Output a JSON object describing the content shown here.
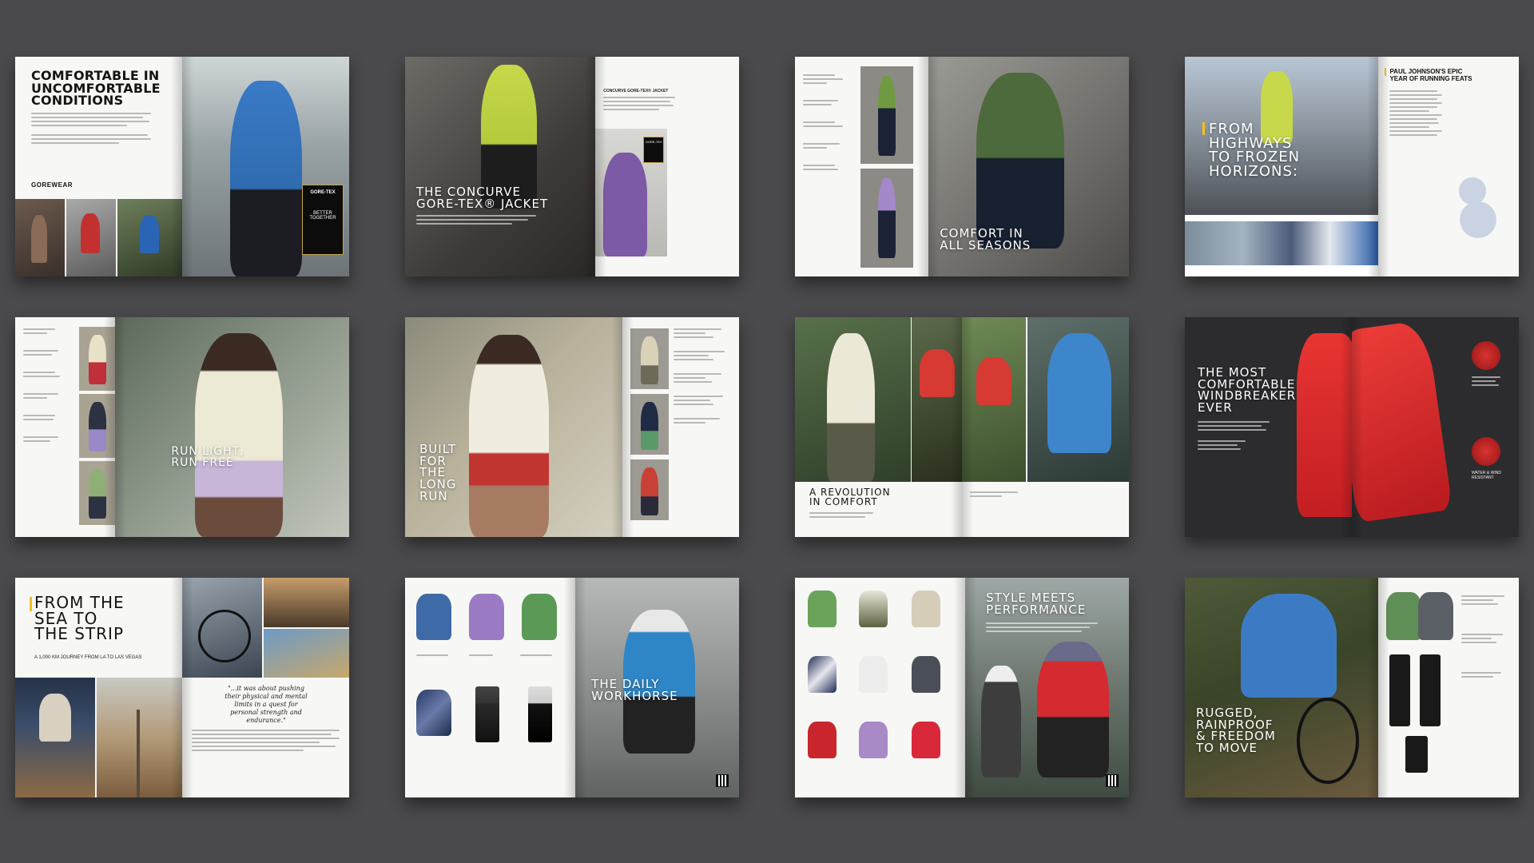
{
  "spreads": [
    {
      "headline": [
        "COMFORTABLE IN",
        "UNCOMFORTABLE",
        "CONDITIONS"
      ],
      "brand": "GOREWEAR",
      "badge": [
        "GORE-TEX",
        "BETTER",
        "TOGETHER"
      ]
    },
    {
      "headline": [
        "THE CONCURVE",
        "GORE-TEX® JACKET"
      ],
      "product_label": "CONCURVE GORE-TEX® JACKET"
    },
    {
      "headline": [
        "COMFORT IN",
        "ALL SEASONS"
      ]
    },
    {
      "headline": [
        "FROM",
        "HIGHWAYS",
        "TO FROZEN",
        "HORIZONS:"
      ],
      "side_title": [
        "PAUL JOHNSON'S EPIC",
        "YEAR OF RUNNING FEATS"
      ]
    },
    {
      "headline": [
        "RUN LIGHT,",
        "RUN FREE"
      ]
    },
    {
      "headline": [
        "BUILT",
        "FOR",
        "THE",
        "LONG",
        "RUN"
      ]
    },
    {
      "headline": [
        "A REVOLUTION",
        "IN COMFORT"
      ]
    },
    {
      "headline": [
        "THE MOST",
        "COMFORTABLE",
        "WINDBREAKER",
        "EVER"
      ],
      "callouts": [
        "WATER & WIND RESISTANT"
      ]
    },
    {
      "headline": [
        "FROM THE",
        "SEA TO",
        "THE STRIP"
      ],
      "subtitle": "A 1,000 KM JOURNEY FROM LA TO LAS VEGAS",
      "quote": "\"...it was about pushing their physical and mental limits in a quest for personal strength and endurance.\""
    },
    {
      "headline": [
        "THE DAILY",
        "WORKHORSE"
      ]
    },
    {
      "headline": [
        "STYLE MEETS",
        "PERFORMANCE"
      ]
    },
    {
      "headline": [
        "RUGGED,",
        "RAINPROOF",
        "& FREEDOM",
        "TO MOVE"
      ]
    }
  ],
  "colors": {
    "background": "#4a4a4c",
    "accent_yellow": "#f2c21b",
    "jacket_red": "#e0262b",
    "jacket_blue": "#2f79c9",
    "jacket_lime": "#c7d84a"
  }
}
